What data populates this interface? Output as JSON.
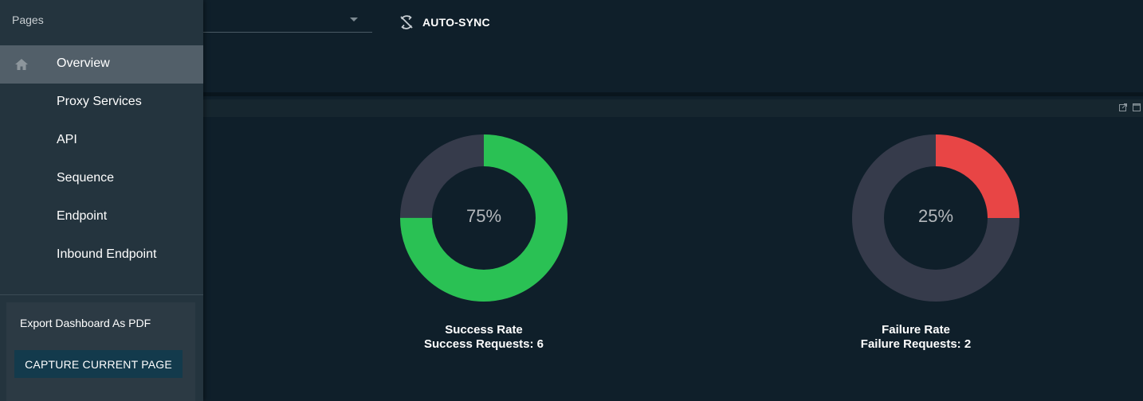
{
  "toolbar": {
    "autosync_label": "AUTO-SYNC"
  },
  "sidebar": {
    "title": "Pages",
    "items": [
      {
        "label": "Overview",
        "active": true,
        "icon": "home-icon"
      },
      {
        "label": "Proxy Services",
        "active": false
      },
      {
        "label": "API",
        "active": false
      },
      {
        "label": "Sequence",
        "active": false
      },
      {
        "label": "Endpoint",
        "active": false
      },
      {
        "label": "Inbound Endpoint",
        "active": false
      }
    ],
    "export": {
      "title": "Export Dashboard As PDF",
      "button_label": "CAPTURE CURRENT PAGE"
    }
  },
  "colors": {
    "success": "#2ac154",
    "failure": "#e84545",
    "track": "#363b4b"
  },
  "widgets": {
    "success": {
      "value_text": "75%",
      "caption_line1": "Success Rate",
      "caption_line2": "Success Requests: 6"
    },
    "failure": {
      "value_text": "25%",
      "caption_line1": "Failure Rate",
      "caption_line2": "Failure Requests: 2"
    }
  },
  "chart_data": [
    {
      "type": "pie",
      "categories": [
        "Success",
        "Other"
      ],
      "values": [
        75,
        25
      ],
      "center_label": "75%"
    },
    {
      "type": "pie",
      "categories": [
        "Failure",
        "Other"
      ],
      "values": [
        25,
        75
      ],
      "center_label": "25%"
    }
  ]
}
